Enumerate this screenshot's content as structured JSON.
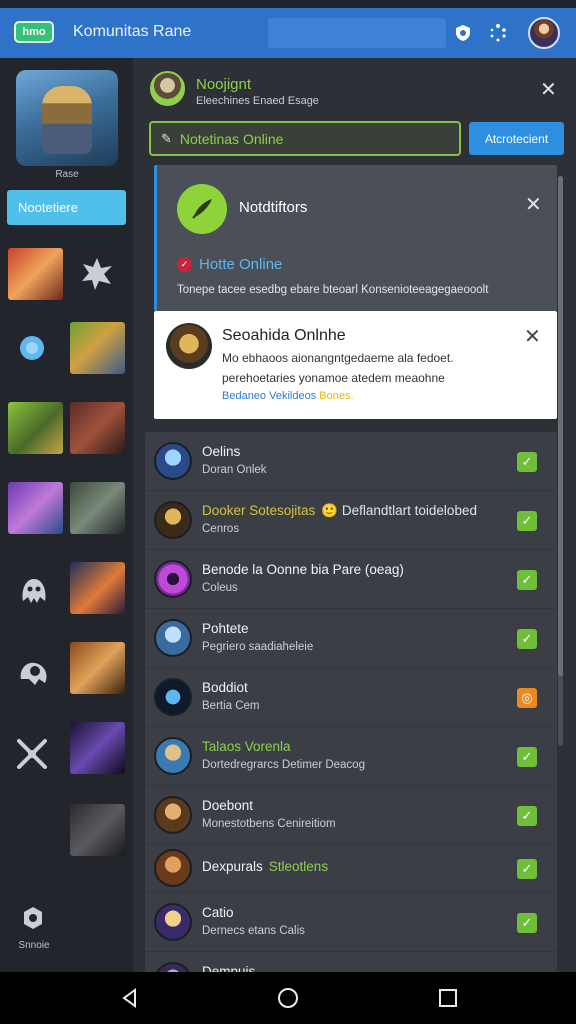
{
  "app": {
    "logo_text": "hmo",
    "title": "Komunitas Rane"
  },
  "sidebar": {
    "hero_caption": "Rase",
    "button_label": "Nootetiere",
    "settings_label": "Snnoie"
  },
  "header": {
    "group_name": "Noojignt",
    "group_sub": "Eleechines Enaed Esage"
  },
  "filter": {
    "value": "Notetinas Online",
    "action_label": "Atcrotecient"
  },
  "notification": {
    "title": "Notdtiftors",
    "status": "Hotte Online",
    "body": "Tonepe tacee esedbg ebare bteoarl Konsenioteeagegaeooolt"
  },
  "toast": {
    "title": "Seoahida Onlnhe",
    "line1": "Mo ebhaoos aionangntgedaeme ala fedoet.",
    "line2": "perehoetaries yonamoe atedem meaohne",
    "link": "Bedaneo Vekildeos",
    "link_highlight": "Bones."
  },
  "members": [
    {
      "name": "Oelins",
      "extra": "",
      "sub": "Doran Onlek",
      "check": "✓"
    },
    {
      "name": "Dooker Sotesojitas",
      "extra": "🙂 Deflandtlart toidelobed",
      "sub": "Cenros",
      "check": "✓"
    },
    {
      "name": "Benode la Oonne bia Pare (oeag)",
      "extra": "",
      "sub": "Coleus",
      "check": "✓"
    },
    {
      "name": "Pohtete",
      "extra": "",
      "sub": "Pegriero saadiaheleie",
      "check": "✓"
    },
    {
      "name": "Boddiot",
      "extra": "",
      "sub": "Bertia Cem",
      "check": "◎"
    },
    {
      "name": "Talaos Vorenla",
      "extra": "",
      "sub": "Dortedregrarcs Detimer Deacog",
      "check": "✓"
    },
    {
      "name": "Doebont",
      "extra": "",
      "sub": "Monestotbens Cenireitiom",
      "check": "✓"
    },
    {
      "name": "Dexpurals",
      "extra": "Stleotlens",
      "sub": "",
      "check": "✓"
    },
    {
      "name": "Catio",
      "extra": "",
      "sub": "Dernecs etans Calis",
      "check": "✓"
    },
    {
      "name": "Dempuis",
      "extra": "",
      "sub": "",
      "check": "✓"
    }
  ],
  "colors": {
    "topbar": "#2f73c9",
    "accent_green": "#8fd04a",
    "accent_blue": "#2e8fe0",
    "sidebar_button": "#4fc0ea"
  }
}
